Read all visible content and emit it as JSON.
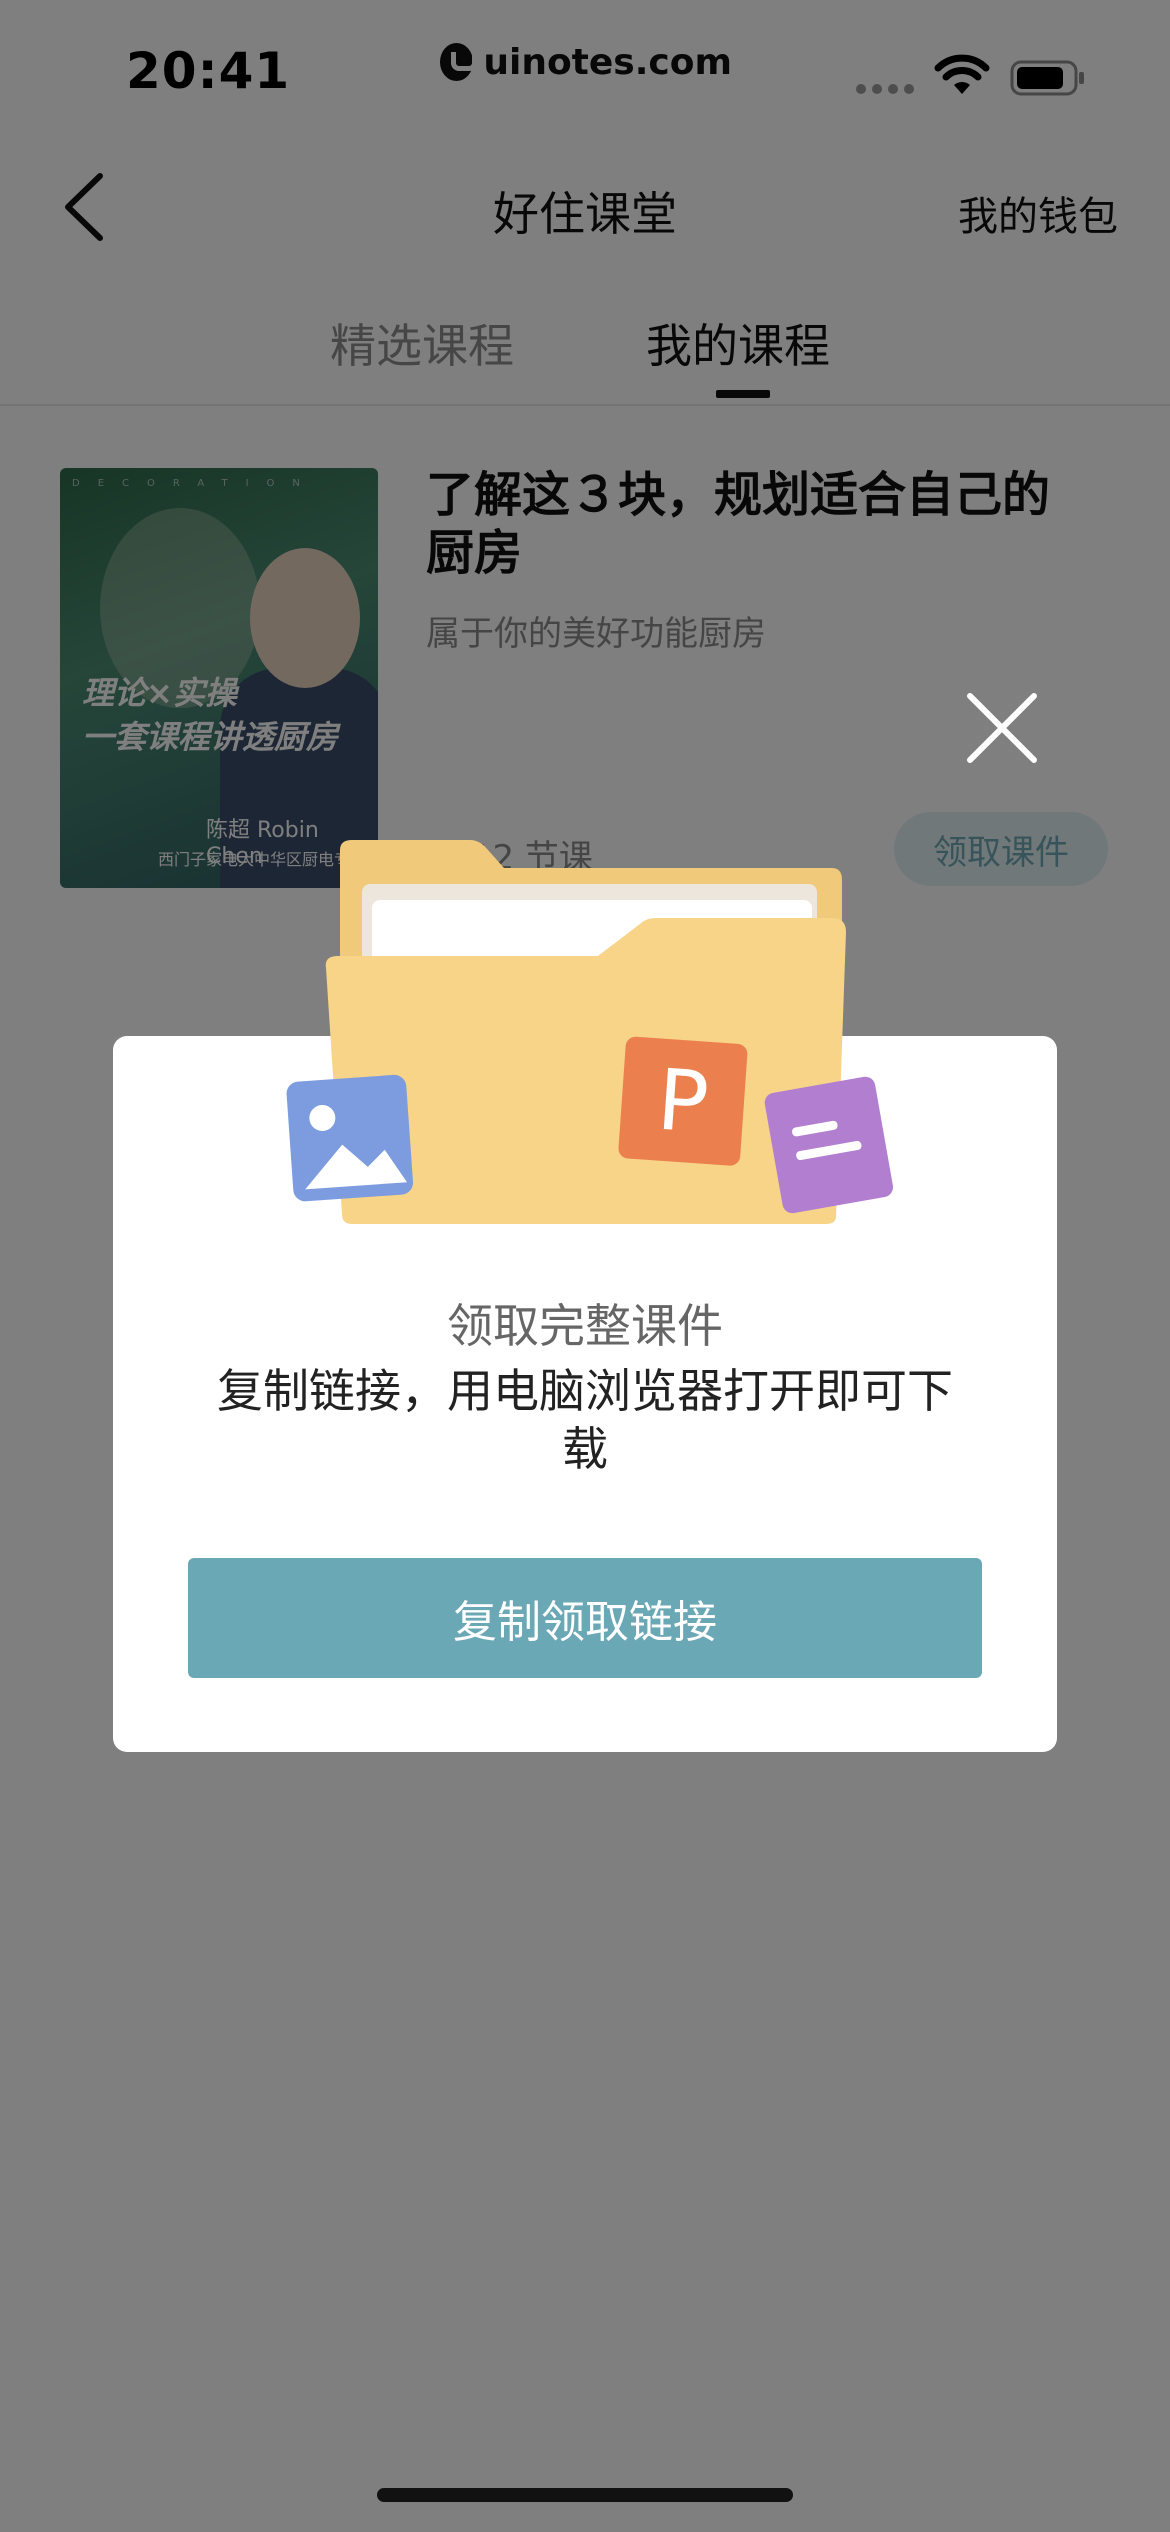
{
  "status_bar": {
    "time": "20:41",
    "watermark": "uinotes.com"
  },
  "nav": {
    "back_icon": "chevron-left-icon",
    "title": "好住课堂",
    "right_label": "我的钱包"
  },
  "tabs": [
    {
      "label": "精选课程",
      "active": false
    },
    {
      "label": "我的课程",
      "active": true
    }
  ],
  "course": {
    "cover": {
      "line1": "理论×实操",
      "line2": "一套课程讲透厨房",
      "name": "陈超 Robin Chen",
      "institution": "西门子家电大中华区厨电专家"
    },
    "title": "了解这３块，规划适合自己的厨房",
    "subtitle": "属于你的美好功能厨房",
    "count": "共 12 节课",
    "action": "领取课件"
  },
  "modal": {
    "title": "领取完整课件",
    "description": "复制链接，用电脑浏览器打开即可下载",
    "button": "复制领取链接",
    "close_icon": "close-icon"
  },
  "colors": {
    "accent": "#6ba8b5",
    "overlay": "rgba(0,0,0,0.5)",
    "folder": "#f6cf7e"
  }
}
